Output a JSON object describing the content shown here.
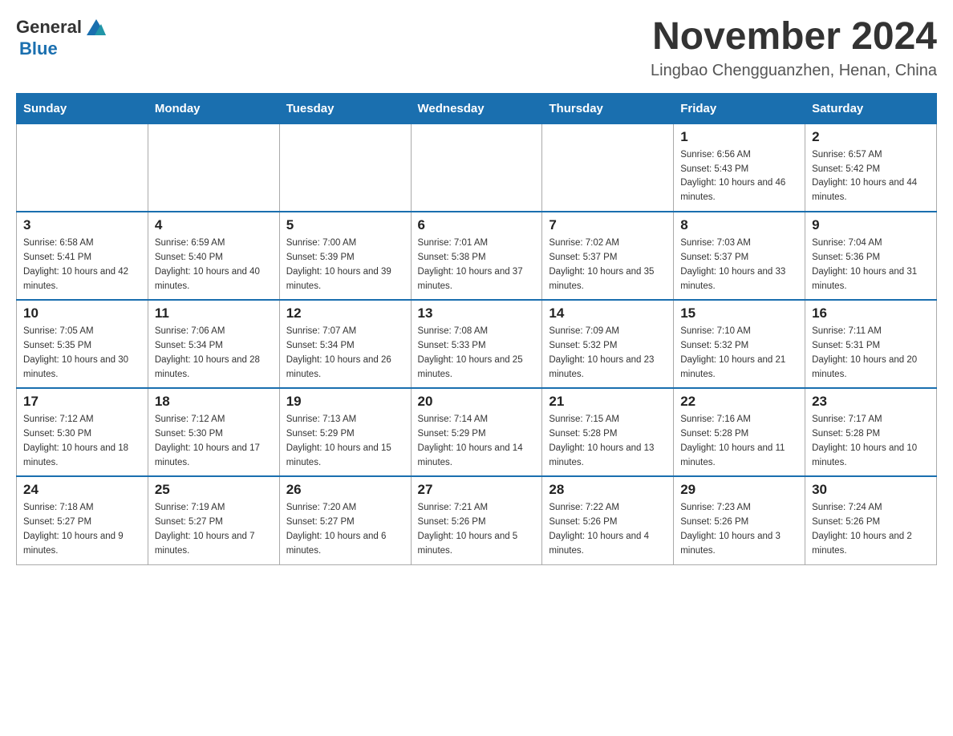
{
  "header": {
    "logo_general": "General",
    "logo_blue": "Blue",
    "month_title": "November 2024",
    "location": "Lingbao Chengguanzhen, Henan, China"
  },
  "weekdays": [
    "Sunday",
    "Monday",
    "Tuesday",
    "Wednesday",
    "Thursday",
    "Friday",
    "Saturday"
  ],
  "weeks": [
    [
      {
        "day": "",
        "info": ""
      },
      {
        "day": "",
        "info": ""
      },
      {
        "day": "",
        "info": ""
      },
      {
        "day": "",
        "info": ""
      },
      {
        "day": "",
        "info": ""
      },
      {
        "day": "1",
        "info": "Sunrise: 6:56 AM\nSunset: 5:43 PM\nDaylight: 10 hours and 46 minutes."
      },
      {
        "day": "2",
        "info": "Sunrise: 6:57 AM\nSunset: 5:42 PM\nDaylight: 10 hours and 44 minutes."
      }
    ],
    [
      {
        "day": "3",
        "info": "Sunrise: 6:58 AM\nSunset: 5:41 PM\nDaylight: 10 hours and 42 minutes."
      },
      {
        "day": "4",
        "info": "Sunrise: 6:59 AM\nSunset: 5:40 PM\nDaylight: 10 hours and 40 minutes."
      },
      {
        "day": "5",
        "info": "Sunrise: 7:00 AM\nSunset: 5:39 PM\nDaylight: 10 hours and 39 minutes."
      },
      {
        "day": "6",
        "info": "Sunrise: 7:01 AM\nSunset: 5:38 PM\nDaylight: 10 hours and 37 minutes."
      },
      {
        "day": "7",
        "info": "Sunrise: 7:02 AM\nSunset: 5:37 PM\nDaylight: 10 hours and 35 minutes."
      },
      {
        "day": "8",
        "info": "Sunrise: 7:03 AM\nSunset: 5:37 PM\nDaylight: 10 hours and 33 minutes."
      },
      {
        "day": "9",
        "info": "Sunrise: 7:04 AM\nSunset: 5:36 PM\nDaylight: 10 hours and 31 minutes."
      }
    ],
    [
      {
        "day": "10",
        "info": "Sunrise: 7:05 AM\nSunset: 5:35 PM\nDaylight: 10 hours and 30 minutes."
      },
      {
        "day": "11",
        "info": "Sunrise: 7:06 AM\nSunset: 5:34 PM\nDaylight: 10 hours and 28 minutes."
      },
      {
        "day": "12",
        "info": "Sunrise: 7:07 AM\nSunset: 5:34 PM\nDaylight: 10 hours and 26 minutes."
      },
      {
        "day": "13",
        "info": "Sunrise: 7:08 AM\nSunset: 5:33 PM\nDaylight: 10 hours and 25 minutes."
      },
      {
        "day": "14",
        "info": "Sunrise: 7:09 AM\nSunset: 5:32 PM\nDaylight: 10 hours and 23 minutes."
      },
      {
        "day": "15",
        "info": "Sunrise: 7:10 AM\nSunset: 5:32 PM\nDaylight: 10 hours and 21 minutes."
      },
      {
        "day": "16",
        "info": "Sunrise: 7:11 AM\nSunset: 5:31 PM\nDaylight: 10 hours and 20 minutes."
      }
    ],
    [
      {
        "day": "17",
        "info": "Sunrise: 7:12 AM\nSunset: 5:30 PM\nDaylight: 10 hours and 18 minutes."
      },
      {
        "day": "18",
        "info": "Sunrise: 7:12 AM\nSunset: 5:30 PM\nDaylight: 10 hours and 17 minutes."
      },
      {
        "day": "19",
        "info": "Sunrise: 7:13 AM\nSunset: 5:29 PM\nDaylight: 10 hours and 15 minutes."
      },
      {
        "day": "20",
        "info": "Sunrise: 7:14 AM\nSunset: 5:29 PM\nDaylight: 10 hours and 14 minutes."
      },
      {
        "day": "21",
        "info": "Sunrise: 7:15 AM\nSunset: 5:28 PM\nDaylight: 10 hours and 13 minutes."
      },
      {
        "day": "22",
        "info": "Sunrise: 7:16 AM\nSunset: 5:28 PM\nDaylight: 10 hours and 11 minutes."
      },
      {
        "day": "23",
        "info": "Sunrise: 7:17 AM\nSunset: 5:28 PM\nDaylight: 10 hours and 10 minutes."
      }
    ],
    [
      {
        "day": "24",
        "info": "Sunrise: 7:18 AM\nSunset: 5:27 PM\nDaylight: 10 hours and 9 minutes."
      },
      {
        "day": "25",
        "info": "Sunrise: 7:19 AM\nSunset: 5:27 PM\nDaylight: 10 hours and 7 minutes."
      },
      {
        "day": "26",
        "info": "Sunrise: 7:20 AM\nSunset: 5:27 PM\nDaylight: 10 hours and 6 minutes."
      },
      {
        "day": "27",
        "info": "Sunrise: 7:21 AM\nSunset: 5:26 PM\nDaylight: 10 hours and 5 minutes."
      },
      {
        "day": "28",
        "info": "Sunrise: 7:22 AM\nSunset: 5:26 PM\nDaylight: 10 hours and 4 minutes."
      },
      {
        "day": "29",
        "info": "Sunrise: 7:23 AM\nSunset: 5:26 PM\nDaylight: 10 hours and 3 minutes."
      },
      {
        "day": "30",
        "info": "Sunrise: 7:24 AM\nSunset: 5:26 PM\nDaylight: 10 hours and 2 minutes."
      }
    ]
  ]
}
